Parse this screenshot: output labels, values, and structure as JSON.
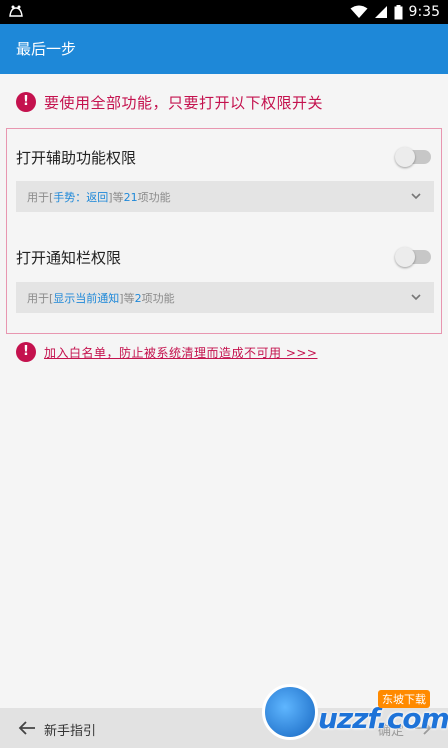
{
  "status_bar": {
    "time": "9:35"
  },
  "app_bar": {
    "title": "最后一步"
  },
  "warning": {
    "text": "要使用全部功能，只要打开以下权限开关"
  },
  "permissions": [
    {
      "title": "打开辅助功能权限",
      "enabled": false,
      "detail_prefix": "用于[",
      "detail_highlight": "手势：返回",
      "detail_suffix": "]等",
      "detail_count": "21",
      "detail_end": "项功能"
    },
    {
      "title": "打开通知栏权限",
      "enabled": false,
      "detail_prefix": "用于[",
      "detail_highlight": "显示当前通知",
      "detail_suffix": "]等",
      "detail_count": "2",
      "detail_end": "项功能"
    }
  ],
  "whitelist": {
    "link_text": "加入白名单，防止被系统清理而造成不可用 >>>"
  },
  "bottom_bar": {
    "guide_label": "新手指引",
    "confirm_label": "确定"
  },
  "watermark": {
    "site": "uzzf.com",
    "tag": "东坡下载"
  },
  "colors": {
    "primary": "#1e88d8",
    "warning": "#c4124e",
    "panel_border": "#e896b0"
  }
}
